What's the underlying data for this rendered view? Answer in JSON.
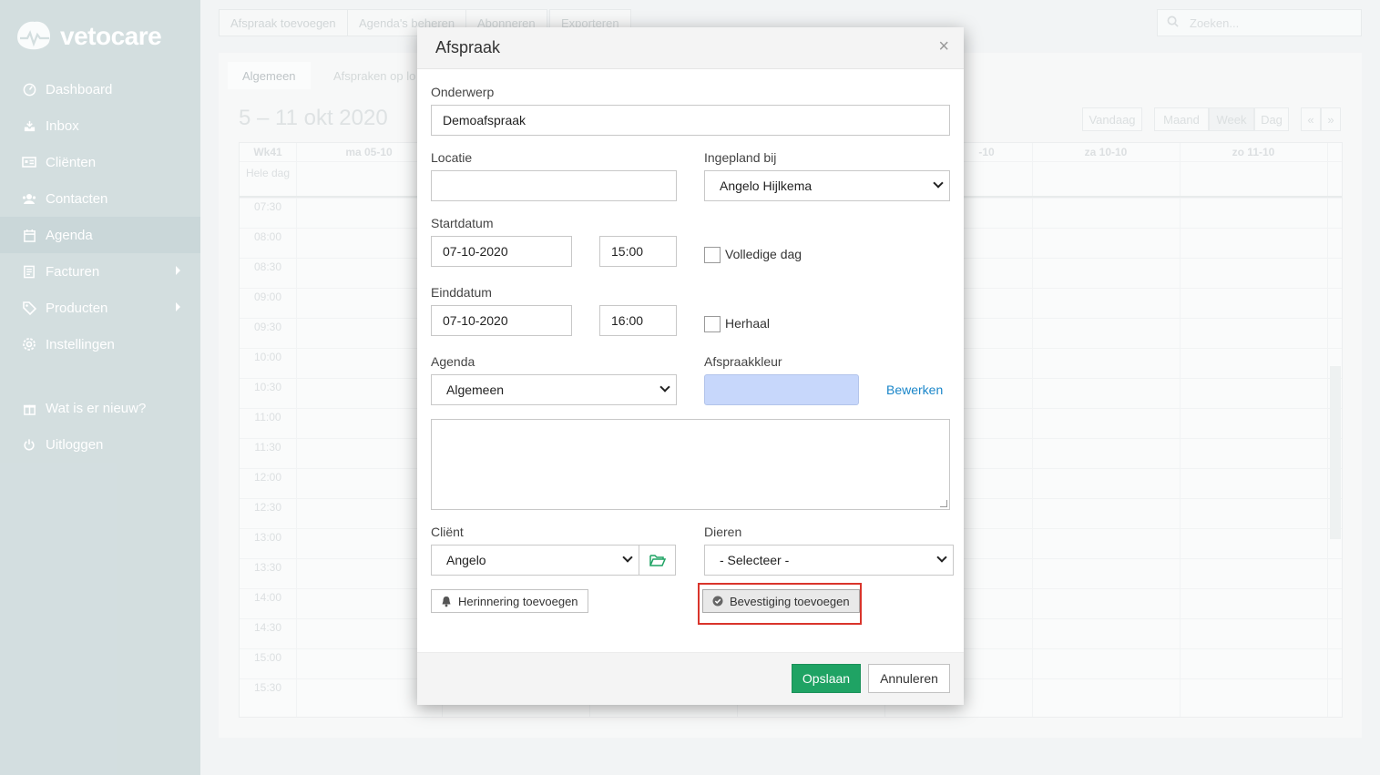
{
  "app": {
    "logo_text": "vetocare"
  },
  "sidebar": {
    "items": [
      {
        "label": "Dashboard",
        "icon": "dashboard-icon"
      },
      {
        "label": "Inbox",
        "icon": "inbox-icon"
      },
      {
        "label": "Cliënten",
        "icon": "clients-icon"
      },
      {
        "label": "Contacten",
        "icon": "contacts-icon"
      },
      {
        "label": "Agenda",
        "icon": "agenda-icon",
        "active": true
      },
      {
        "label": "Facturen",
        "icon": "invoices-icon",
        "has_submenu": true
      },
      {
        "label": "Producten",
        "icon": "products-icon",
        "has_submenu": true
      },
      {
        "label": "Instellingen",
        "icon": "settings-icon"
      }
    ],
    "secondary_items": [
      {
        "label": "Wat is er nieuw?",
        "icon": "gift-icon"
      },
      {
        "label": "Uitloggen",
        "icon": "power-icon"
      }
    ]
  },
  "toolbar": {
    "add_appointment": "Afspraak toevoegen",
    "manage_agendas": "Agenda's beheren",
    "subscribe": "Abonneren",
    "export": "Exporteren",
    "search_placeholder": "Zoeken..."
  },
  "calendar": {
    "tabs": [
      "Algemeen",
      "Afspraken op lo"
    ],
    "range_title": "5 – 11 okt 2020",
    "today_label": "Vandaag",
    "views": [
      "Maand",
      "Week",
      "Dag"
    ],
    "active_view": "Week",
    "prev_label": "«",
    "next_label": "»",
    "week_label": "Wk41",
    "all_day_label": "Hele dag",
    "day_headers": [
      "ma 05-10",
      "-10",
      "za 10-10",
      "zo 11-10"
    ],
    "times": [
      "07:30",
      "08:00",
      "08:30",
      "09:00",
      "09:30",
      "10:00",
      "10:30",
      "11:00",
      "11:30",
      "12:00",
      "12:30",
      "13:00",
      "13:30",
      "14:00",
      "14:30",
      "15:00",
      "15:30"
    ]
  },
  "modal": {
    "title": "Afspraak",
    "close_glyph": "×",
    "subject_label": "Onderwerp",
    "subject_value": "Demoafspraak",
    "location_label": "Locatie",
    "location_value": "",
    "planned_with_label": "Ingepland bij",
    "planned_with_value": "Angelo Hijlkema",
    "start_date_label": "Startdatum",
    "start_date_value": "07-10-2020",
    "start_time_value": "15:00",
    "full_day_label": "Volledige dag",
    "full_day_checked": false,
    "end_date_label": "Einddatum",
    "end_date_value": "07-10-2020",
    "end_time_value": "16:00",
    "repeat_label": "Herhaal",
    "repeat_checked": false,
    "agenda_label": "Agenda",
    "agenda_value": "Algemeen",
    "color_label": "Afspraakkleur",
    "color_value": "#c7d7fb",
    "edit_link": "Bewerken",
    "notes_value": "",
    "client_label": "Cliënt",
    "client_value": "Angelo",
    "animals_label": "Dieren",
    "animals_value": "- Selecteer -",
    "reminder_button": "Herinnering toevoegen",
    "confirmation_button": "Bevestiging toevoegen",
    "save_button": "Opslaan",
    "cancel_button": "Annuleren"
  },
  "colors": {
    "sidebar_bg": "#c4d3d5",
    "primary_green": "#1fa364",
    "link_blue": "#1a86c9",
    "highlight_red": "#d9342b"
  }
}
